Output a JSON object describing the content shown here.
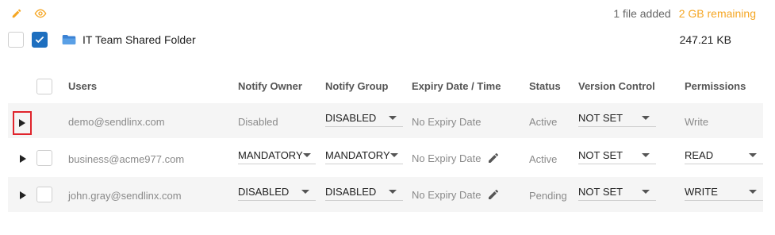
{
  "summary": {
    "files_added": "1 file added",
    "remaining": "2 GB remaining"
  },
  "folder": {
    "name": "IT Team Shared Folder",
    "size": "247.21 KB"
  },
  "columns": {
    "users": "Users",
    "notify_owner": "Notify Owner",
    "notify_group": "Notify Group",
    "expiry": "Expiry Date / Time",
    "status": "Status",
    "version_control": "Version Control",
    "permissions": "Permissions"
  },
  "rows": [
    {
      "email": "demo@sendlinx.com",
      "notify_owner": "Disabled",
      "notify_group": "DISABLED",
      "expiry": "No Expiry Date",
      "status": "Active",
      "version_control": "NOT SET",
      "permissions": "Write"
    },
    {
      "email": "business@acme977.com",
      "notify_owner": "MANDATORY",
      "notify_group": "MANDATORY",
      "expiry": "No Expiry Date",
      "status": "Active",
      "version_control": "NOT SET",
      "permissions": "READ"
    },
    {
      "email": "john.gray@sendlinx.com",
      "notify_owner": "DISABLED",
      "notify_group": "DISABLED",
      "expiry": "No Expiry Date",
      "status": "Pending",
      "version_control": "NOT SET",
      "permissions": "WRITE"
    }
  ],
  "colors": {
    "accent": "#1e6fbf",
    "remaining": "#f5a623",
    "highlight": "#e0242c"
  },
  "icons": [
    "pencil-icon",
    "eye-icon",
    "folder-icon",
    "check-icon",
    "play-icon",
    "caret-down-icon"
  ]
}
